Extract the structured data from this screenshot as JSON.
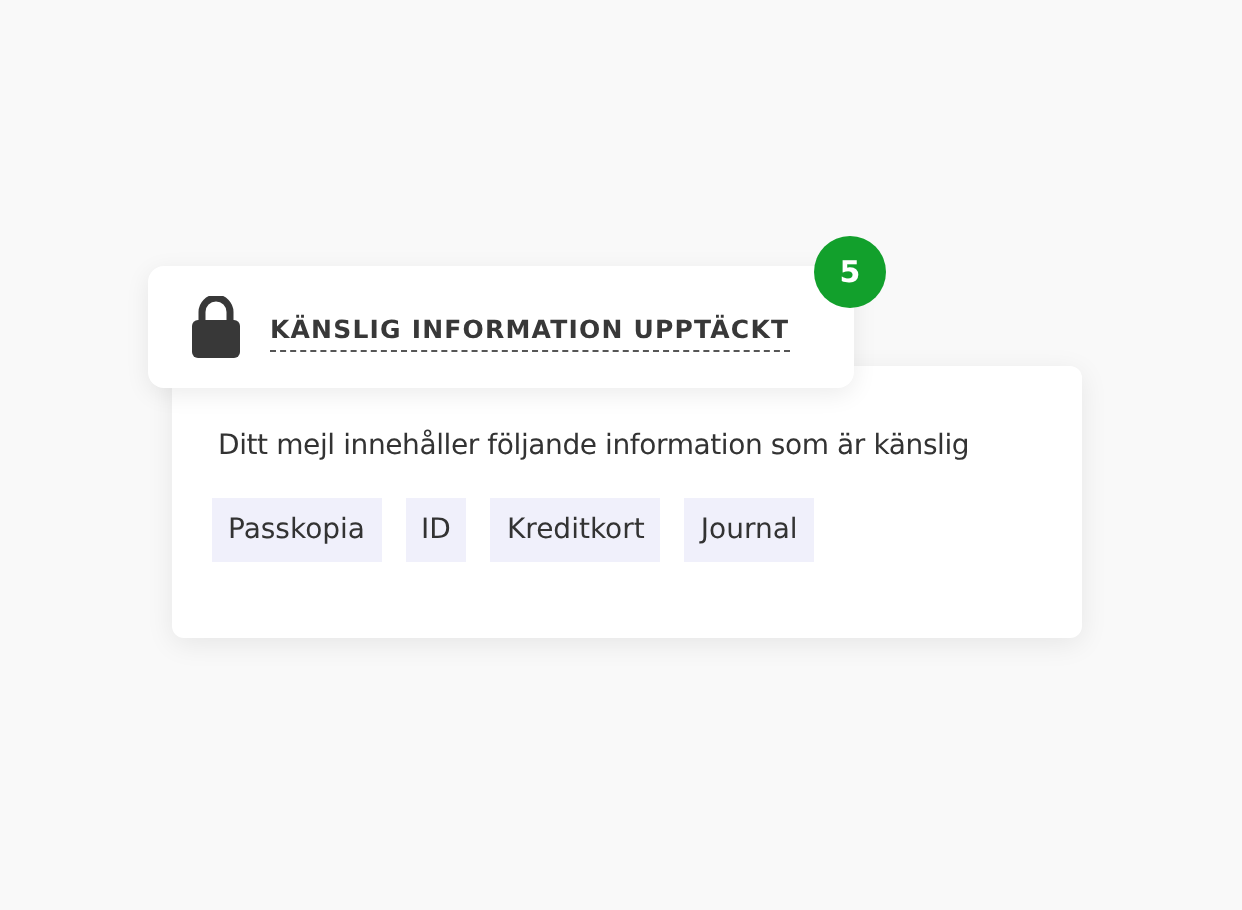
{
  "alert": {
    "title": "KÄNSLIG INFORMATION UPPTÄCKT",
    "count": "5"
  },
  "details": {
    "message": "Ditt mejl innehåller följande information som är känslig",
    "tags": [
      "Passkopia",
      "ID",
      "Kreditkort",
      "Journal"
    ]
  }
}
